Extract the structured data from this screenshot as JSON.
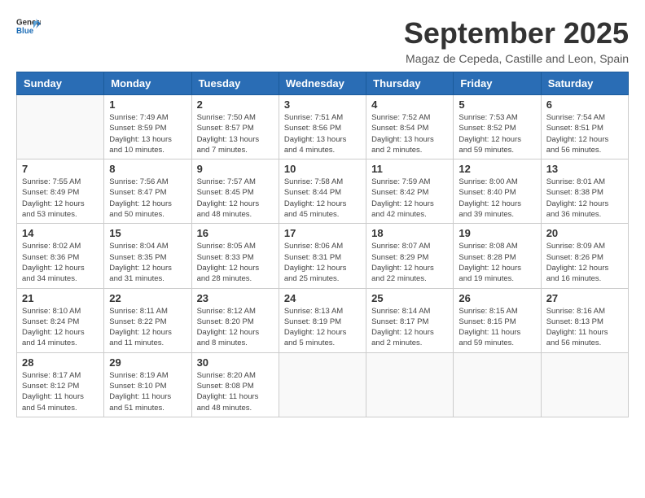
{
  "header": {
    "logo_general": "General",
    "logo_blue": "Blue",
    "month_title": "September 2025",
    "location": "Magaz de Cepeda, Castille and Leon, Spain"
  },
  "weekdays": [
    "Sunday",
    "Monday",
    "Tuesday",
    "Wednesday",
    "Thursday",
    "Friday",
    "Saturday"
  ],
  "weeks": [
    [
      {
        "day": "",
        "info": ""
      },
      {
        "day": "1",
        "info": "Sunrise: 7:49 AM\nSunset: 8:59 PM\nDaylight: 13 hours\nand 10 minutes."
      },
      {
        "day": "2",
        "info": "Sunrise: 7:50 AM\nSunset: 8:57 PM\nDaylight: 13 hours\nand 7 minutes."
      },
      {
        "day": "3",
        "info": "Sunrise: 7:51 AM\nSunset: 8:56 PM\nDaylight: 13 hours\nand 4 minutes."
      },
      {
        "day": "4",
        "info": "Sunrise: 7:52 AM\nSunset: 8:54 PM\nDaylight: 13 hours\nand 2 minutes."
      },
      {
        "day": "5",
        "info": "Sunrise: 7:53 AM\nSunset: 8:52 PM\nDaylight: 12 hours\nand 59 minutes."
      },
      {
        "day": "6",
        "info": "Sunrise: 7:54 AM\nSunset: 8:51 PM\nDaylight: 12 hours\nand 56 minutes."
      }
    ],
    [
      {
        "day": "7",
        "info": "Sunrise: 7:55 AM\nSunset: 8:49 PM\nDaylight: 12 hours\nand 53 minutes."
      },
      {
        "day": "8",
        "info": "Sunrise: 7:56 AM\nSunset: 8:47 PM\nDaylight: 12 hours\nand 50 minutes."
      },
      {
        "day": "9",
        "info": "Sunrise: 7:57 AM\nSunset: 8:45 PM\nDaylight: 12 hours\nand 48 minutes."
      },
      {
        "day": "10",
        "info": "Sunrise: 7:58 AM\nSunset: 8:44 PM\nDaylight: 12 hours\nand 45 minutes."
      },
      {
        "day": "11",
        "info": "Sunrise: 7:59 AM\nSunset: 8:42 PM\nDaylight: 12 hours\nand 42 minutes."
      },
      {
        "day": "12",
        "info": "Sunrise: 8:00 AM\nSunset: 8:40 PM\nDaylight: 12 hours\nand 39 minutes."
      },
      {
        "day": "13",
        "info": "Sunrise: 8:01 AM\nSunset: 8:38 PM\nDaylight: 12 hours\nand 36 minutes."
      }
    ],
    [
      {
        "day": "14",
        "info": "Sunrise: 8:02 AM\nSunset: 8:36 PM\nDaylight: 12 hours\nand 34 minutes."
      },
      {
        "day": "15",
        "info": "Sunrise: 8:04 AM\nSunset: 8:35 PM\nDaylight: 12 hours\nand 31 minutes."
      },
      {
        "day": "16",
        "info": "Sunrise: 8:05 AM\nSunset: 8:33 PM\nDaylight: 12 hours\nand 28 minutes."
      },
      {
        "day": "17",
        "info": "Sunrise: 8:06 AM\nSunset: 8:31 PM\nDaylight: 12 hours\nand 25 minutes."
      },
      {
        "day": "18",
        "info": "Sunrise: 8:07 AM\nSunset: 8:29 PM\nDaylight: 12 hours\nand 22 minutes."
      },
      {
        "day": "19",
        "info": "Sunrise: 8:08 AM\nSunset: 8:28 PM\nDaylight: 12 hours\nand 19 minutes."
      },
      {
        "day": "20",
        "info": "Sunrise: 8:09 AM\nSunset: 8:26 PM\nDaylight: 12 hours\nand 16 minutes."
      }
    ],
    [
      {
        "day": "21",
        "info": "Sunrise: 8:10 AM\nSunset: 8:24 PM\nDaylight: 12 hours\nand 14 minutes."
      },
      {
        "day": "22",
        "info": "Sunrise: 8:11 AM\nSunset: 8:22 PM\nDaylight: 12 hours\nand 11 minutes."
      },
      {
        "day": "23",
        "info": "Sunrise: 8:12 AM\nSunset: 8:20 PM\nDaylight: 12 hours\nand 8 minutes."
      },
      {
        "day": "24",
        "info": "Sunrise: 8:13 AM\nSunset: 8:19 PM\nDaylight: 12 hours\nand 5 minutes."
      },
      {
        "day": "25",
        "info": "Sunrise: 8:14 AM\nSunset: 8:17 PM\nDaylight: 12 hours\nand 2 minutes."
      },
      {
        "day": "26",
        "info": "Sunrise: 8:15 AM\nSunset: 8:15 PM\nDaylight: 11 hours\nand 59 minutes."
      },
      {
        "day": "27",
        "info": "Sunrise: 8:16 AM\nSunset: 8:13 PM\nDaylight: 11 hours\nand 56 minutes."
      }
    ],
    [
      {
        "day": "28",
        "info": "Sunrise: 8:17 AM\nSunset: 8:12 PM\nDaylight: 11 hours\nand 54 minutes."
      },
      {
        "day": "29",
        "info": "Sunrise: 8:19 AM\nSunset: 8:10 PM\nDaylight: 11 hours\nand 51 minutes."
      },
      {
        "day": "30",
        "info": "Sunrise: 8:20 AM\nSunset: 8:08 PM\nDaylight: 11 hours\nand 48 minutes."
      },
      {
        "day": "",
        "info": ""
      },
      {
        "day": "",
        "info": ""
      },
      {
        "day": "",
        "info": ""
      },
      {
        "day": "",
        "info": ""
      }
    ]
  ]
}
